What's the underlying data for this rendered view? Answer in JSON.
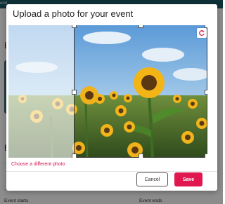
{
  "background": {
    "topbar_text": "ood",
    "section_letter_1": "E",
    "section_letter_2": "E",
    "event_starts_label": "Event starts",
    "event_ends_label": "Event ends"
  },
  "modal": {
    "title": "Upload a photo for your event",
    "choose_link": "Choose a different photo",
    "cancel_label": "Cancel",
    "save_label": "Save"
  },
  "icons": {
    "rotate": "rotate-icon"
  },
  "colors": {
    "accent": "#e0184f",
    "link": "#d6124e",
    "topbar": "#1b5a66"
  }
}
